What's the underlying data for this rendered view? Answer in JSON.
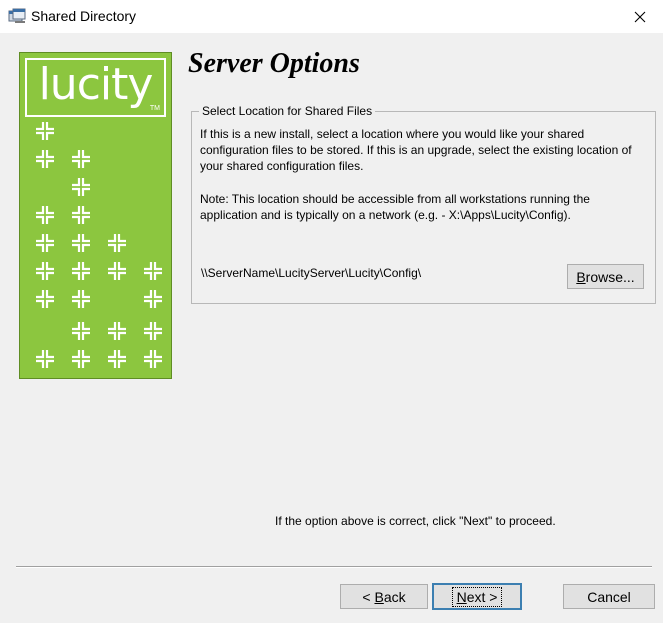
{
  "window": {
    "title": "Shared Directory",
    "app_icon": "setup-window-icon",
    "close_icon": "close-icon"
  },
  "banner": {
    "logo_text": "lucity",
    "logo_tm": "TM",
    "accent_color": "#8cc63f",
    "pattern_icon": "cross-pattern-icon"
  },
  "page": {
    "heading": "Server Options"
  },
  "group": {
    "legend": "Select Location for Shared Files",
    "paragraph1": "If this is a new install, select a location where you would like your shared configuration files to be stored. If this is an upgrade, select the existing location of your shared configuration files.",
    "paragraph2": "Note: This location should be accessible from all workstations running the application and is typically on a network (e.g. - X:\\Apps\\Lucity\\Config).",
    "path": "\\\\ServerName\\LucityServer\\Lucity\\Config\\",
    "browse": {
      "mnemonic": "B",
      "rest": "rowse..."
    }
  },
  "footer": {
    "hint": "If the option above is correct, click \"Next\" to proceed.",
    "back": {
      "prefix": "< ",
      "mnemonic": "B",
      "rest": "ack"
    },
    "next": {
      "mnemonic": "N",
      "rest": "ext >"
    },
    "cancel": "Cancel"
  }
}
